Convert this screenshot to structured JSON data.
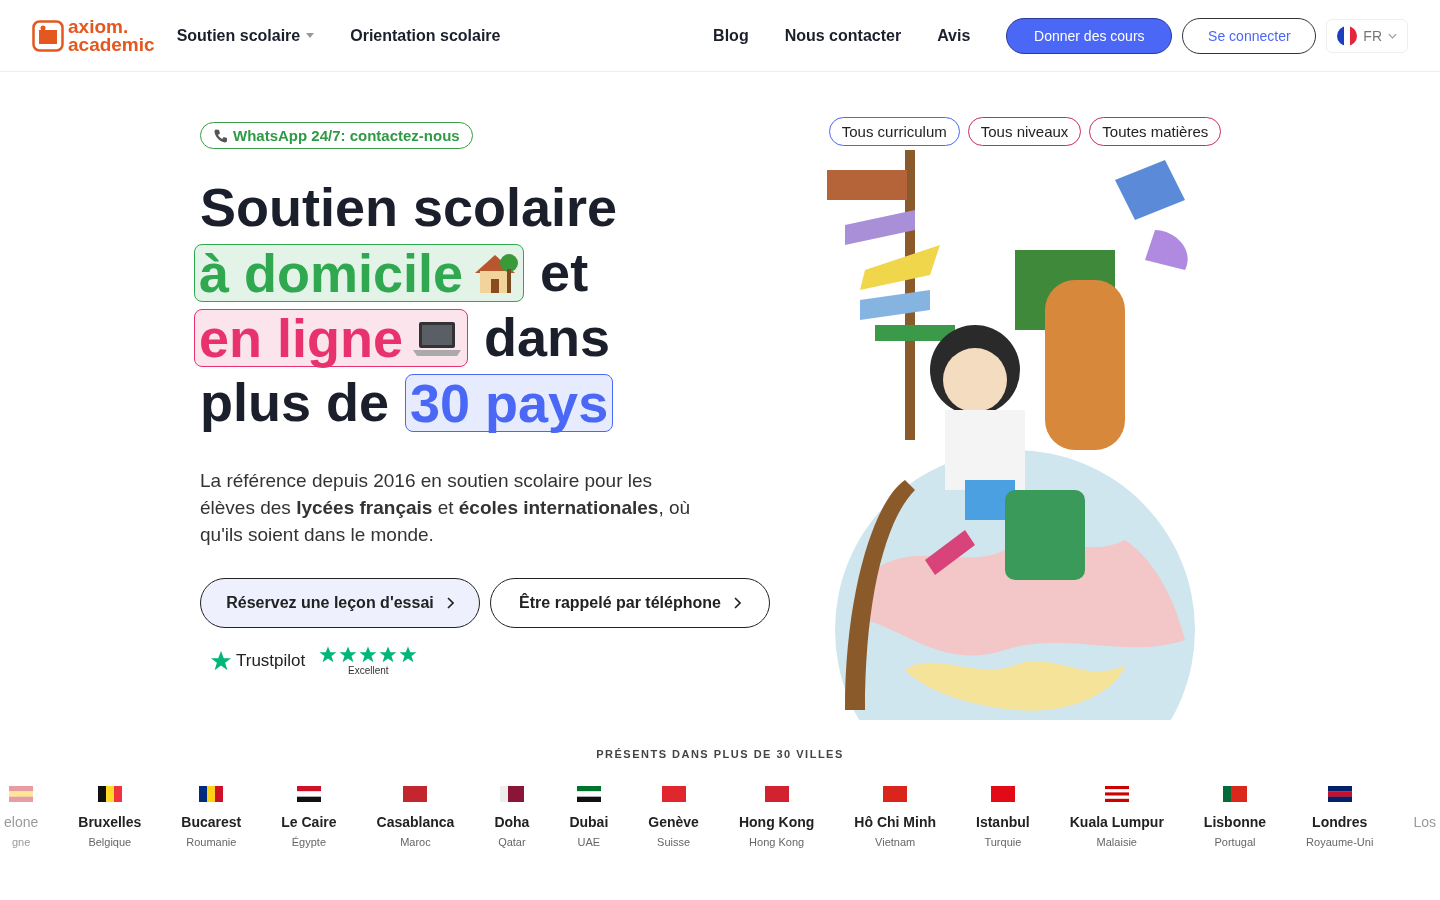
{
  "header": {
    "logo": [
      "axiom.",
      "academic"
    ],
    "nav": [
      {
        "label": "Soutien scolaire",
        "dropdown": true
      },
      {
        "label": "Orientation scolaire",
        "dropdown": false
      }
    ],
    "nav_right": [
      "Blog",
      "Nous contacter",
      "Avis"
    ],
    "buttons": [
      {
        "label": "Donner des cours",
        "kind": "primary"
      },
      {
        "label": "Se connecter",
        "kind": "outline"
      }
    ],
    "language": "FR"
  },
  "hero": {
    "whatsapp": "WhatsApp 24/7: contactez-nous",
    "headline": [
      [
        {
          "text": "Soutien scolaire",
          "kind": "plain"
        }
      ],
      [
        {
          "text": "à domicile",
          "kind": "highlight",
          "color": "#2fa84f"
        },
        {
          "text": "et",
          "kind": "plain"
        }
      ],
      [
        {
          "text": "en ligne",
          "kind": "highlight",
          "color": "#e8326e"
        },
        {
          "text": "dans",
          "kind": "plain"
        }
      ],
      [
        {
          "text": "plus de",
          "kind": "plain"
        },
        {
          "text": "30 pays",
          "kind": "highlight",
          "color": "#4a67f5"
        }
      ]
    ],
    "lead": "La référence depuis 2016 en soutien scolaire pour les élèves des **lycées français** et **écoles internationales**, où qu'ils soient dans le monde.",
    "ctas": [
      {
        "label": "Réservez une leçon d'essai",
        "kind": "filled"
      },
      {
        "label": "Être rappelé par téléphone",
        "kind": "outline"
      }
    ],
    "trustpilot": {
      "brand": "Trustpilot",
      "stars": 5,
      "rating": "Excellent"
    },
    "filters": [
      {
        "label": "Tous curriculum",
        "color": "#4a67f5"
      },
      {
        "label": "Tous niveaux",
        "color": "#c2305f"
      },
      {
        "label": "Toutes matières",
        "color": "#c2305f"
      }
    ]
  },
  "cities": {
    "title": "PRÉSENTS DANS PLUS DE 30 VILLES",
    "items": [
      {
        "city": "elone",
        "country": "gne",
        "faded": true
      },
      {
        "city": "Bruxelles",
        "country": "Belgique",
        "faded": false
      },
      {
        "city": "Bucarest",
        "country": "Roumanie",
        "faded": false
      },
      {
        "city": "Le Caire",
        "country": "Égypte",
        "faded": false
      },
      {
        "city": "Casablanca",
        "country": "Maroc",
        "faded": false
      },
      {
        "city": "Doha",
        "country": "Qatar",
        "faded": false
      },
      {
        "city": "Dubai",
        "country": "UAE",
        "faded": false
      },
      {
        "city": "Genève",
        "country": "Suisse",
        "faded": false
      },
      {
        "city": "Hong Kong",
        "country": "Hong Kong",
        "faded": false
      },
      {
        "city": "Hô Chi Minh",
        "country": "Vietnam",
        "faded": false
      },
      {
        "city": "Istanbul",
        "country": "Turquie",
        "faded": false
      },
      {
        "city": "Kuala Lumpur",
        "country": "Malaisie",
        "faded": false
      },
      {
        "city": "Lisbonne",
        "country": "Portugal",
        "faded": false
      },
      {
        "city": "Londres",
        "country": "Royaume-Uni",
        "faded": false
      },
      {
        "city": "Los",
        "faded": true
      }
    ]
  }
}
